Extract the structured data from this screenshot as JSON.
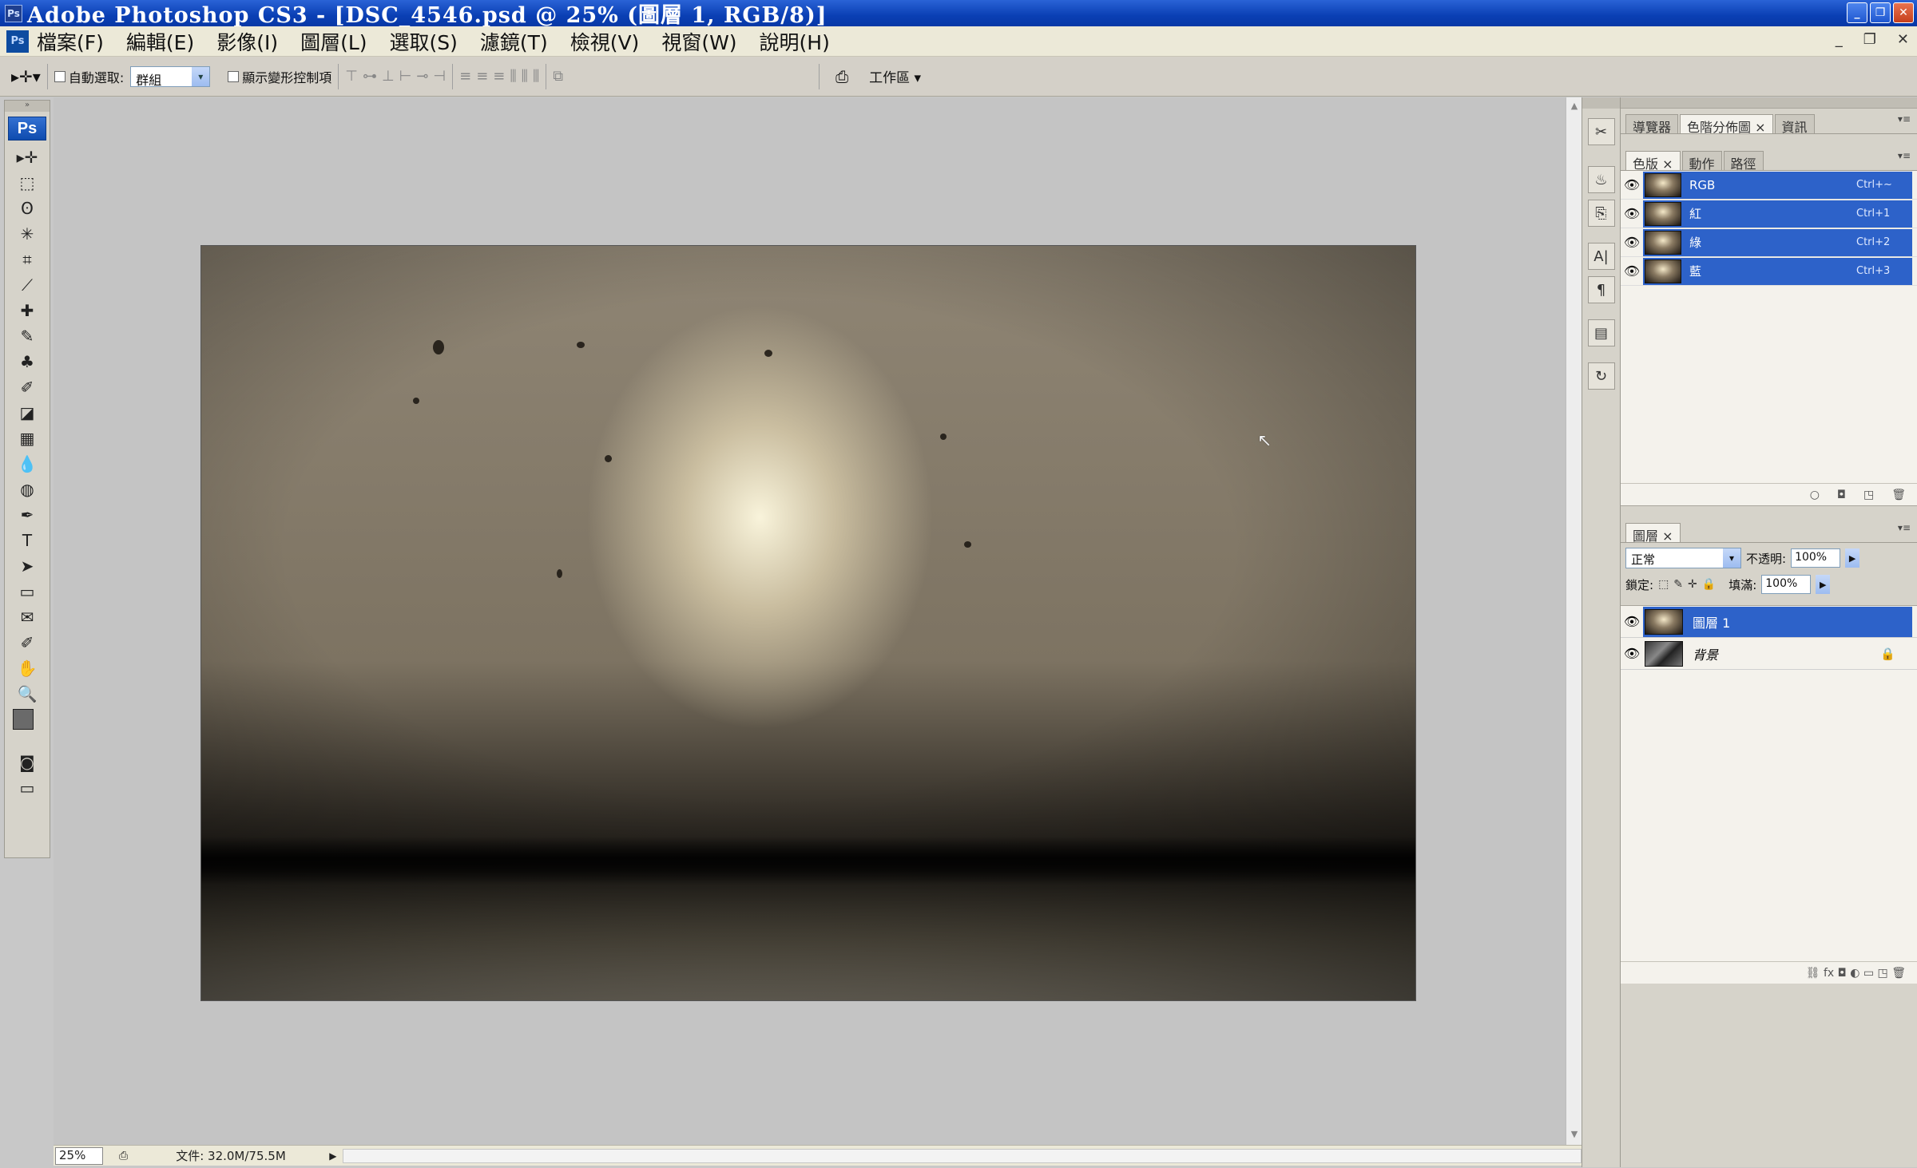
{
  "window": {
    "title": "Adobe Photoshop CS3 - [DSC_4546.psd @ 25% (圖層 1, RGB/8)]",
    "controls": [
      "minimize",
      "restore",
      "close"
    ]
  },
  "menubar": {
    "items": [
      "檔案(F)",
      "編輯(E)",
      "影像(I)",
      "圖層(L)",
      "選取(S)",
      "濾鏡(T)",
      "檢視(V)",
      "視窗(W)",
      "說明(H)"
    ]
  },
  "options": {
    "auto_select_label": "自動選取:",
    "auto_select_value": "群組",
    "show_transform_label": "顯示變形控制項",
    "workspace_label": "工作區 ▾"
  },
  "toolbox": {
    "logo": "Ps",
    "tools": [
      "move-tool",
      "marquee-tool",
      "lasso-tool",
      "magic-wand-tool",
      "crop-tool",
      "slice-tool",
      "healing-brush-tool",
      "brush-tool",
      "clone-stamp-tool",
      "history-brush-tool",
      "eraser-tool",
      "gradient-tool",
      "blur-tool",
      "dodge-tool",
      "pen-tool",
      "type-tool",
      "path-selection-tool",
      "shape-tool",
      "notes-tool",
      "eyedropper-tool",
      "hand-tool",
      "zoom-tool"
    ],
    "tool_glyphs": [
      "▸✛",
      "⬚",
      "ʘ",
      "✳",
      "⌗",
      "⟋",
      "✚",
      "✎",
      "♣",
      "✐",
      "◪",
      "▦",
      "💧",
      "◍",
      "✒",
      "T",
      "➤",
      "▭",
      "✉",
      "✐",
      "✋",
      "🔍"
    ]
  },
  "status": {
    "zoom": "25%",
    "doc_info": "文件: 32.0M/75.5M"
  },
  "panels": {
    "top_tabs": [
      "導覽器",
      "色階分佈圖 ×",
      "資訊"
    ],
    "channel_tabs": [
      "色版 ×",
      "動作",
      "路徑"
    ],
    "channels": [
      {
        "name": "RGB",
        "shortcut": "Ctrl+~"
      },
      {
        "name": "紅",
        "shortcut": "Ctrl+1"
      },
      {
        "name": "綠",
        "shortcut": "Ctrl+2"
      },
      {
        "name": "藍",
        "shortcut": "Ctrl+3"
      }
    ],
    "layers_tab": "圖層 ×",
    "blend_mode": "正常",
    "opacity_label": "不透明:",
    "opacity_value": "100%",
    "lock_label": "鎖定:",
    "fill_label": "填滿:",
    "fill_value": "100%",
    "layers": [
      {
        "name": "圖層 1",
        "selected": true
      },
      {
        "name": "背景",
        "selected": false
      }
    ],
    "layer_footer": "⛓  fx  ◘  ◐  ▭  ◳  🗑"
  },
  "colors": {
    "title_bar": "#0a3fb4",
    "selection": "#2d62c9",
    "panel_bg": "#d6d3ca"
  }
}
